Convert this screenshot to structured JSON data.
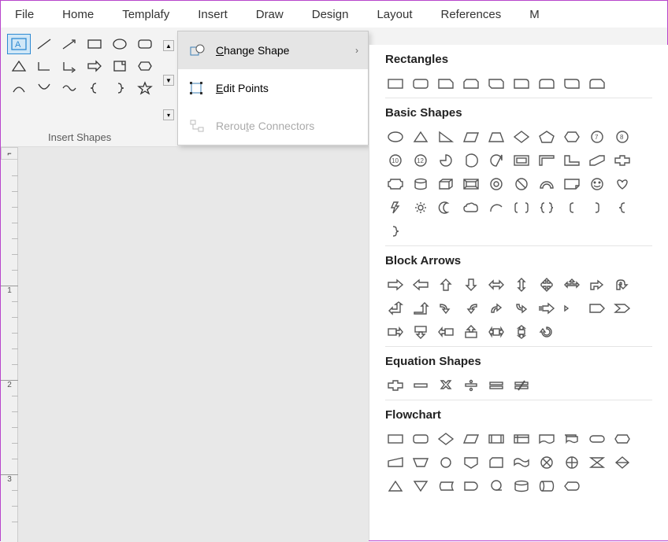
{
  "menubar": [
    "File",
    "Home",
    "Templafy",
    "Insert",
    "Draw",
    "Design",
    "Layout",
    "References",
    "M"
  ],
  "ribbon": {
    "group_label": "Insert Shapes"
  },
  "dropdown": {
    "items": [
      {
        "label": "Change Shape",
        "u": "C",
        "rest": "hange Shape",
        "enabled": true,
        "hasSub": true,
        "highlighted": true
      },
      {
        "label": "Edit Points",
        "u": "E",
        "rest": "dit Points",
        "enabled": true,
        "hasSub": false,
        "highlighted": false
      },
      {
        "label": "Reroute Connectors",
        "u": "t",
        "pre": "Rerou",
        "rest": "e Connectors",
        "enabled": false,
        "hasSub": false,
        "highlighted": false
      }
    ]
  },
  "panel": {
    "sections": [
      {
        "title": "Rectangles",
        "count": 9
      },
      {
        "title": "Basic Shapes",
        "count": 42
      },
      {
        "title": "Block Arrows",
        "count": 27
      },
      {
        "title": "Equation Shapes",
        "count": 6
      },
      {
        "title": "Flowchart",
        "count": 28
      }
    ]
  },
  "ruler": {
    "major": [
      "1",
      "2",
      "3"
    ]
  }
}
